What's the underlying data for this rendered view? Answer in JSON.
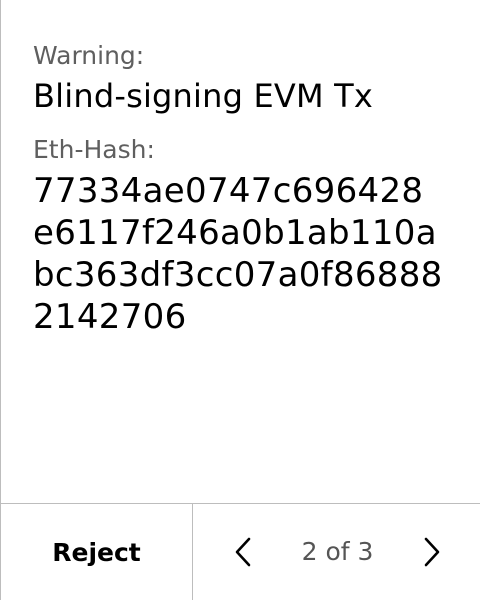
{
  "screen": {
    "warning_label": "Warning:",
    "warning_value": "Blind-signing EVM Tx",
    "hash_label": "Eth-Hash:",
    "hash_value": "77334ae0747c696428e6117f246a0b1ab110abc363df3cc07a0f868882142706"
  },
  "footer": {
    "reject_label": "Reject",
    "page_indicator": "2 of 3",
    "prev_icon": "chevron-left-icon",
    "next_icon": "chevron-right-icon"
  },
  "colors": {
    "text": "#000000",
    "label": "#5f5f5f",
    "divider": "#bdbdbd"
  }
}
